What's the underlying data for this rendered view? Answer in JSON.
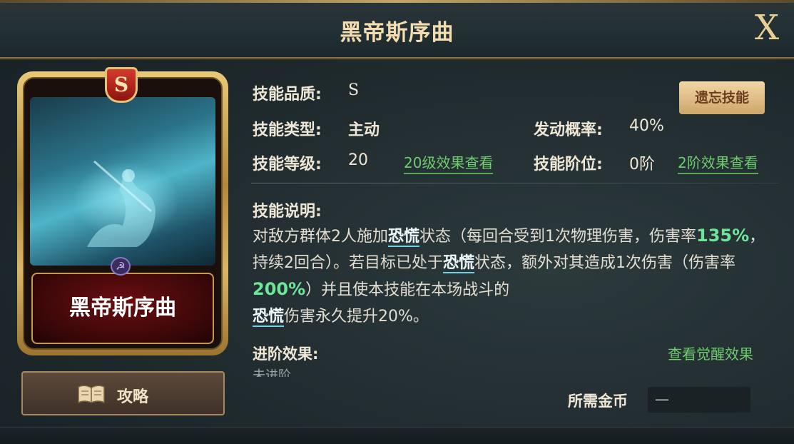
{
  "header": {
    "title": "黑帝斯序曲",
    "close_label": "X"
  },
  "card": {
    "grade": "S",
    "name": "黑帝斯序曲",
    "faction_icon": "☭"
  },
  "strategy_button": {
    "label": "攻略"
  },
  "skill": {
    "quality_label": "技能品质:",
    "quality_value": "S",
    "type_label": "技能类型:",
    "type_value": "主动",
    "level_label": "技能等级:",
    "level_value": "20",
    "level_link": "20级效果查看",
    "rate_label": "发动概率:",
    "rate_value": "40%",
    "rank_label": "技能阶位:",
    "rank_value": "0阶",
    "rank_link": "2阶效果查看",
    "forget_button": "遗忘技能"
  },
  "description": {
    "heading": "技能说明:",
    "p1": "对敌方群体2人施加",
    "kw1": "恐慌",
    "p2": "状态（每回合受到1次物理伤害，伤害率",
    "pct1": "135%",
    "p3": "，持续2回合）。若目标已处于",
    "kw2": "恐慌",
    "p4": "状态，额外对其造成1次伤害（伤害率",
    "pct2": "200%",
    "p5": "）并且使本技能在本场战斗的",
    "kw3": "恐慌",
    "p6": "伤害永久提升20%。"
  },
  "advance": {
    "heading": "进阶效果:",
    "link": "查看觉醒效果",
    "partial_text": "未进阶"
  },
  "cost": {
    "label": "所需金币",
    "value": "—"
  },
  "colors": {
    "gold": "#e9cf94",
    "green_link": "#6fcb6f",
    "percent": "#6ee69a",
    "keyword_underline": "#6ed4e8"
  }
}
